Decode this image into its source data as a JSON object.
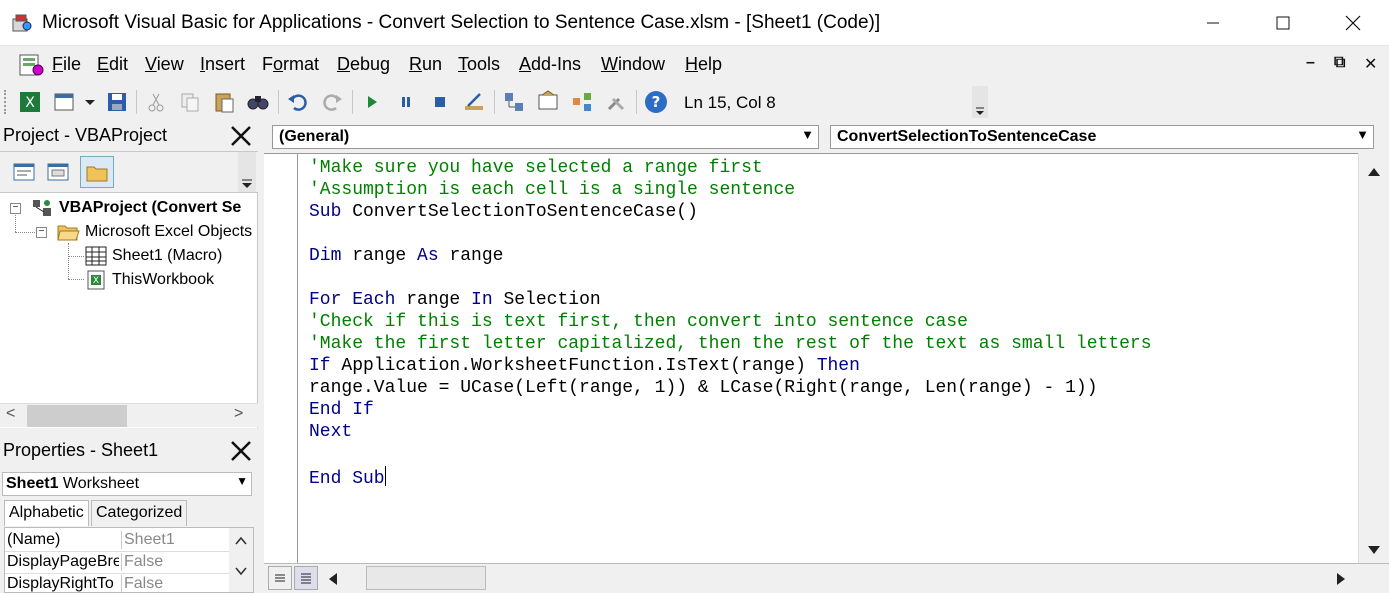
{
  "window": {
    "title": "Microsoft Visual Basic for Applications - Convert Selection to Sentence Case.xlsm - [Sheet1 (Code)]",
    "minimize": "—",
    "maximize": "☐",
    "close": "✕"
  },
  "menu": {
    "items": [
      {
        "label": "File",
        "mnemonic": "F",
        "rest": "ile"
      },
      {
        "label": "Edit",
        "mnemonic": "E",
        "rest": "dit"
      },
      {
        "label": "View",
        "mnemonic": "V",
        "rest": "iew"
      },
      {
        "label": "Insert",
        "mnemonic": "I",
        "rest": "nsert"
      },
      {
        "label": "Format",
        "mnemonic": "o",
        "pre": "F",
        "rest": "rmat"
      },
      {
        "label": "Debug",
        "mnemonic": "D",
        "rest": "ebug"
      },
      {
        "label": "Run",
        "mnemonic": "R",
        "rest": "un"
      },
      {
        "label": "Tools",
        "mnemonic": "T",
        "rest": "ools"
      },
      {
        "label": "Add-Ins",
        "mnemonic": "A",
        "rest": "dd-Ins"
      },
      {
        "label": "Window",
        "mnemonic": "W",
        "rest": "indow"
      },
      {
        "label": "Help",
        "mnemonic": "H",
        "rest": "elp"
      }
    ],
    "mdi_minimize": "–",
    "mdi_restore": "⧉",
    "mdi_close": "✕"
  },
  "toolbar": {
    "status": "Ln 15, Col 8",
    "icons": [
      "view-excel-icon",
      "insert-userform-icon",
      "save-icon",
      "cut-icon",
      "copy-icon",
      "paste-icon",
      "find-icon",
      "undo-icon",
      "redo-icon",
      "run-icon",
      "break-icon",
      "reset-icon",
      "design-mode-icon",
      "project-explorer-icon",
      "properties-window-icon",
      "object-browser-icon",
      "toolbox-icon",
      "help-icon"
    ]
  },
  "project": {
    "title": "Project - VBAProject",
    "tree": {
      "root": "VBAProject (Convert Se",
      "folder": "Microsoft Excel Objects",
      "items": [
        "Sheet1 (Macro)",
        "ThisWorkbook"
      ]
    }
  },
  "properties": {
    "title": "Properties - Sheet1",
    "object_name": "Sheet1",
    "object_type": "Worksheet",
    "tabs": [
      "Alphabetic",
      "Categorized"
    ],
    "rows": [
      {
        "name": "(Name)",
        "value": "Sheet1"
      },
      {
        "name": "DisplayPageBre",
        "value": "False"
      },
      {
        "name": "DisplayRightTo",
        "value": "False"
      }
    ]
  },
  "code": {
    "object_combo": "(General)",
    "procedure_combo": "ConvertSelectionToSentenceCase",
    "lines": [
      "'Make sure you have selected a range first",
      "'Assumption is each cell is a single sentence",
      "Sub ConvertSelectionToSentenceCase()",
      "",
      "Dim range As range",
      "",
      "For Each range In Selection",
      "'Check if this is text first, then convert into sentence case",
      "'Make the first letter capitalized, then the rest of the text as small letters",
      "If Application.WorksheetFunction.IsText(range) Then",
      "range.Value = UCase(Left(range, 1)) & LCase(Right(range, Len(range) - 1))",
      "End If",
      "Next",
      "",
      "End Sub"
    ]
  },
  "colors": {
    "keyword": "#00008b",
    "comment": "#008000",
    "text": "#000000"
  }
}
